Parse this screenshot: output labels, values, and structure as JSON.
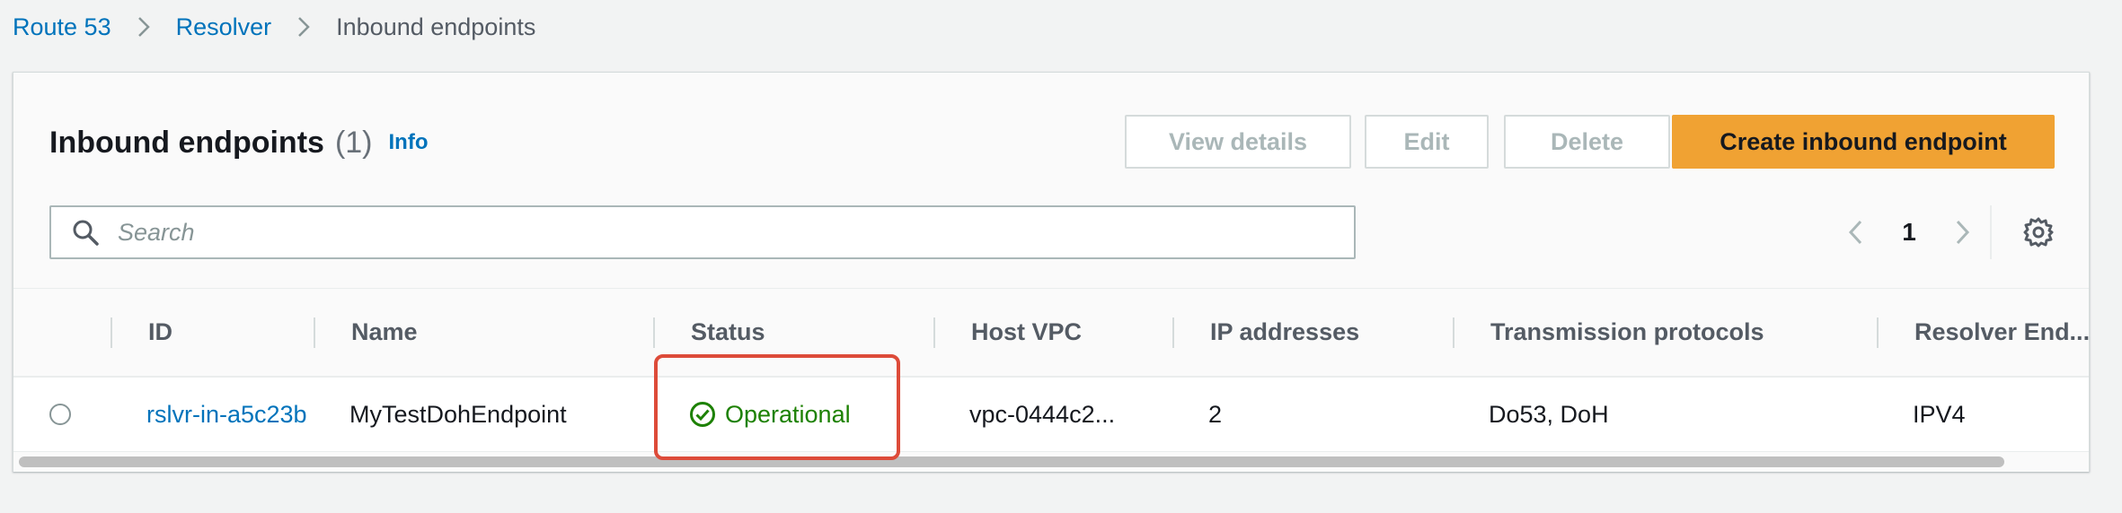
{
  "breadcrumb": {
    "items": [
      "Route 53",
      "Resolver"
    ],
    "current": "Inbound endpoints"
  },
  "header": {
    "title": "Inbound endpoints",
    "count": "(1)",
    "info": "Info"
  },
  "actions": {
    "view_details": "View details",
    "edit": "Edit",
    "delete": "Delete",
    "create": "Create inbound endpoint"
  },
  "search": {
    "placeholder": "Search",
    "value": ""
  },
  "pagination": {
    "current_page": "1"
  },
  "table": {
    "columns": [
      "ID",
      "Name",
      "Status",
      "Host VPC",
      "IP addresses",
      "Transmission protocols",
      "Resolver End..."
    ],
    "rows": [
      {
        "id": "rslvr-in-a5c23b",
        "name": "MyTestDohEndpoint",
        "status": "Operational",
        "host_vpc": "vpc-0444c2...",
        "ip_addresses": "2",
        "transmission_protocols": "Do53, DoH",
        "resolver_endpoint_type": "IPV4"
      }
    ]
  },
  "colors": {
    "link": "#0073bb",
    "primary": "#f0a233",
    "success": "#1d8102",
    "highlight": "#dd4b39"
  }
}
